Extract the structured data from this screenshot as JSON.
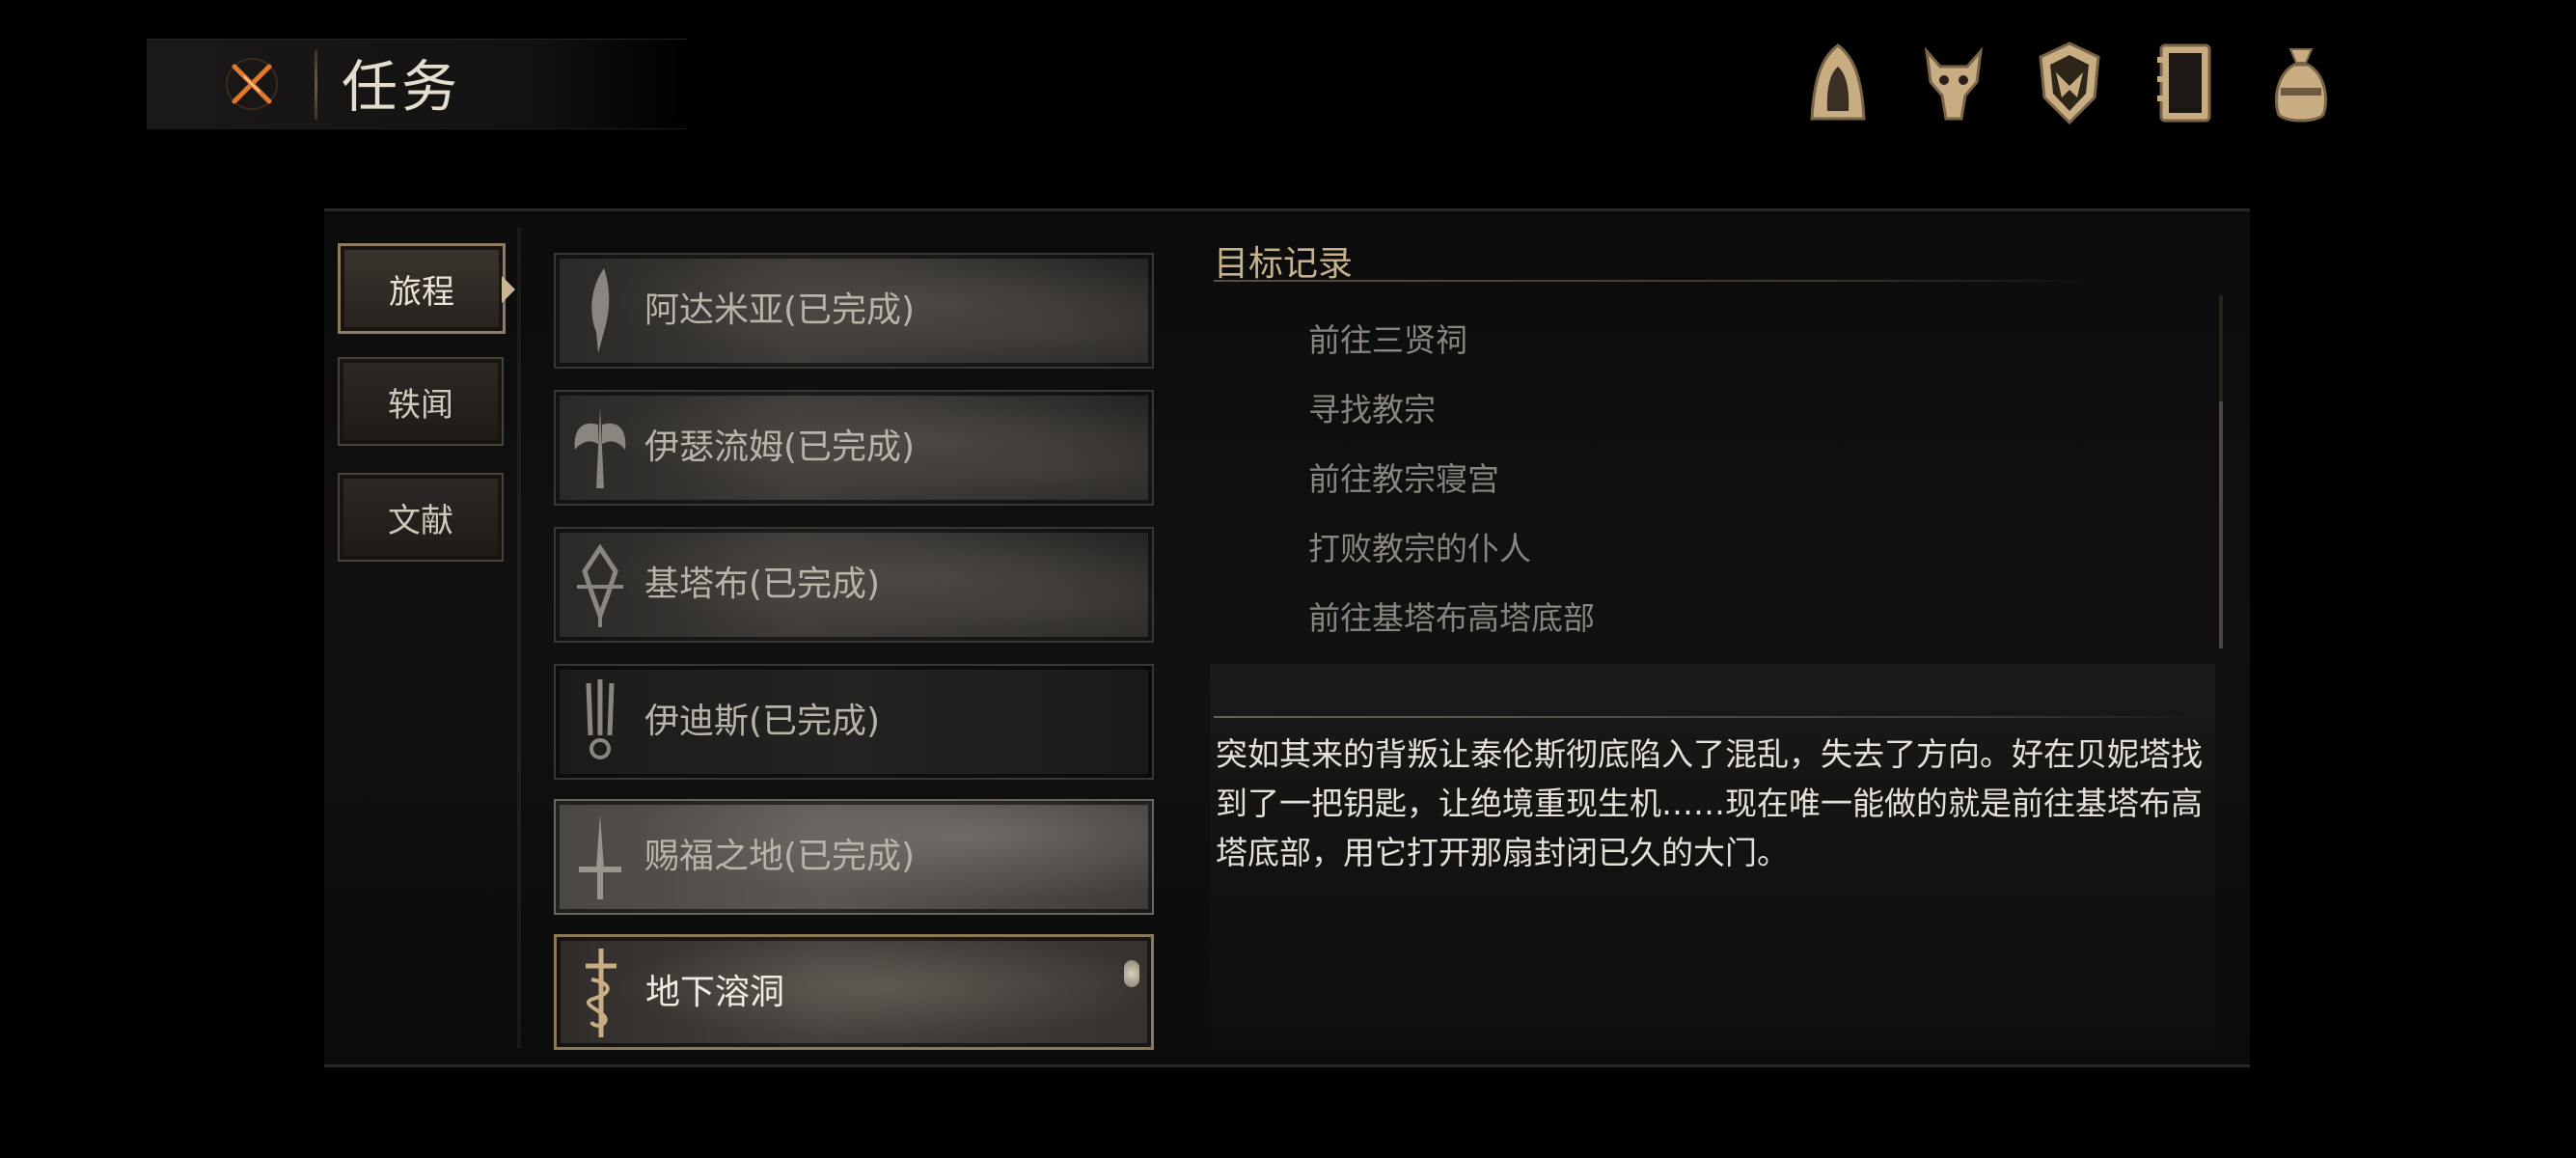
{
  "header": {
    "title": "任务",
    "close_icon": "close-x-icon"
  },
  "top_icons": [
    {
      "name": "hood-icon"
    },
    {
      "name": "wolf-skull-icon"
    },
    {
      "name": "shield-crest-icon"
    },
    {
      "name": "journal-icon"
    },
    {
      "name": "money-bag-icon"
    }
  ],
  "tabs": [
    {
      "label": "旅程",
      "active": true
    },
    {
      "label": "轶闻",
      "active": false
    },
    {
      "label": "文献",
      "active": false
    }
  ],
  "quests": [
    {
      "label": "阿达米亚(已完成)",
      "emblem": "blade-emblem-icon"
    },
    {
      "label": "伊瑟流姆(已完成)",
      "emblem": "winged-emblem-icon"
    },
    {
      "label": "基塔布(已完成)",
      "emblem": "thorn-crest-icon"
    },
    {
      "label": "伊迪斯(已完成)",
      "emblem": "trident-emblem-icon"
    },
    {
      "label": "赐福之地(已完成)",
      "emblem": "sword-emblem-icon"
    },
    {
      "label": "地下溶洞",
      "emblem": "serpent-sword-icon"
    }
  ],
  "objectives": {
    "title": "目标记录",
    "items": [
      "前往三贤祠",
      "寻找教宗",
      "前往教宗寝宫",
      "打败教宗的仆人",
      "前往基塔布高塔底部"
    ]
  },
  "description": "突如其来的背叛让泰伦斯彻底陷入了混乱，失去了方向。好在贝妮塔找到了一把钥匙，让绝境重现生机……现在唯一能做的就是前往基塔布高塔底部，用它打开那扇封闭已久的大门。",
  "colors": {
    "accent_gold": "#c6b28a",
    "close_orange": "#e0782e",
    "icon_tan": "#c9ad82"
  }
}
